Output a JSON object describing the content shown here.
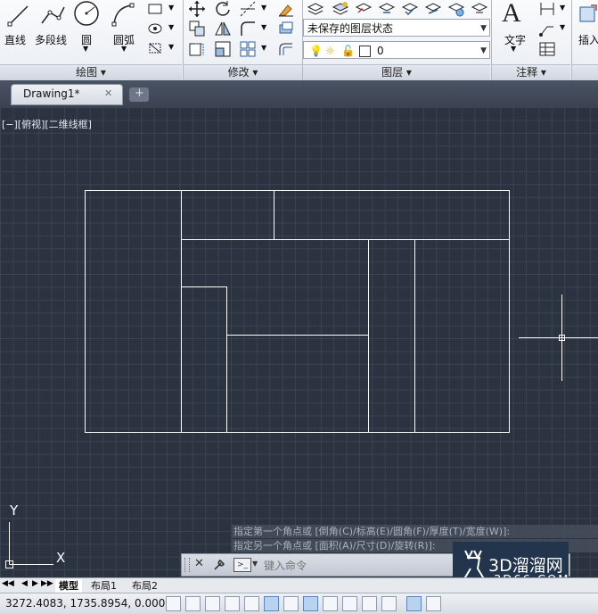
{
  "ribbon": {
    "draw": {
      "line_label": "直线",
      "polyline_label": "多段线",
      "circle_label": "圆",
      "arc_label": "圆弧",
      "panel_title": "绘图 ▾"
    },
    "modify": {
      "panel_title": "修改 ▾"
    },
    "layers": {
      "state_combo": "未保存的图层状态",
      "layer_combo": "0",
      "panel_title": "图层 ▾"
    },
    "annotation": {
      "text_label": "文字",
      "panel_title": "注释 ▾"
    },
    "insert": {
      "label": "插入"
    }
  },
  "tabs": {
    "document": "Drawing1*",
    "close": "✕"
  },
  "viewport": {
    "label": "[−][俯视][二维线框]"
  },
  "ucs": {
    "y": "Y",
    "x": "X"
  },
  "command": {
    "history": [
      "指定第一个角点或 [倒角(C)/标高(E)/圆角(F)/厚度(T)/宽度(W)]:",
      "指定另一个角点或 [面积(A)/尺寸(D)/旋转(R)]:"
    ],
    "placeholder": "键入命令"
  },
  "layout_tabs": [
    "模型",
    "布局1",
    "布局2"
  ],
  "status": {
    "coords": "3272.4083, 1735.8954, 0.0000"
  },
  "watermark": {
    "title": "3D溜溜网",
    "url": "3D66.COM"
  },
  "colors": {
    "canvas": "#2b3340",
    "grid": "#3a4352",
    "geometry": "#ffffff",
    "accent": "#5b87c0"
  }
}
